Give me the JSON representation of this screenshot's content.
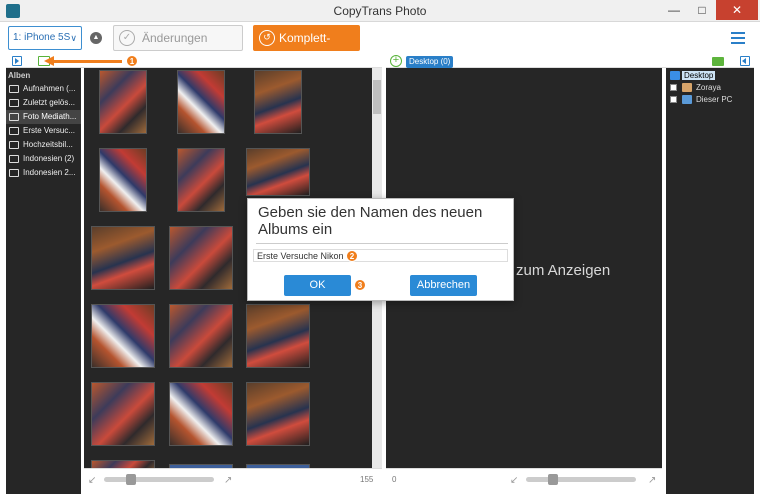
{
  "window": {
    "title": "CopyTrans Photo",
    "minimize": "—",
    "maximize": "□",
    "close": "✕"
  },
  "toolbar": {
    "device": "1: iPhone 5S",
    "device_chevron": "∨",
    "save_label": "Änderungen speichern",
    "save_icon": "✓",
    "backup_label": "Komplett-Backup",
    "backup_icon": "↺",
    "eject_icon": "▲"
  },
  "albums": {
    "header": "Alben",
    "items": [
      {
        "label": "Aufnahmen (..."
      },
      {
        "label": "Zuletzt gelös..."
      },
      {
        "label": "Foto Mediath..."
      },
      {
        "label": "Erste Versuc..."
      },
      {
        "label": "Hochzeitsbil..."
      },
      {
        "label": "Indonesien (2)"
      },
      {
        "label": "Indonesien 2..."
      }
    ]
  },
  "callouts": {
    "step1": "1",
    "step2": "2",
    "step3": "3"
  },
  "right_panel": {
    "tab": "Desktop (0)",
    "plus": "+",
    "empty_text": "zum Anzeigen"
  },
  "tree": {
    "items": [
      {
        "label": "Desktop"
      },
      {
        "label": "Zoraya"
      },
      {
        "label": "Dieser PC"
      }
    ]
  },
  "status": {
    "left_count": "155",
    "right_count": "0",
    "shrink": "↙",
    "expand": "↗"
  },
  "dialog": {
    "title": "Geben sie den Namen des neuen Albums ein",
    "input_value": "Erste Versuche Nikon",
    "ok_label": "OK",
    "cancel_label": "Abbrechen"
  },
  "colors": {
    "accent": "#2a7fc8",
    "backup": "#f07e1c",
    "panel": "#262626"
  }
}
